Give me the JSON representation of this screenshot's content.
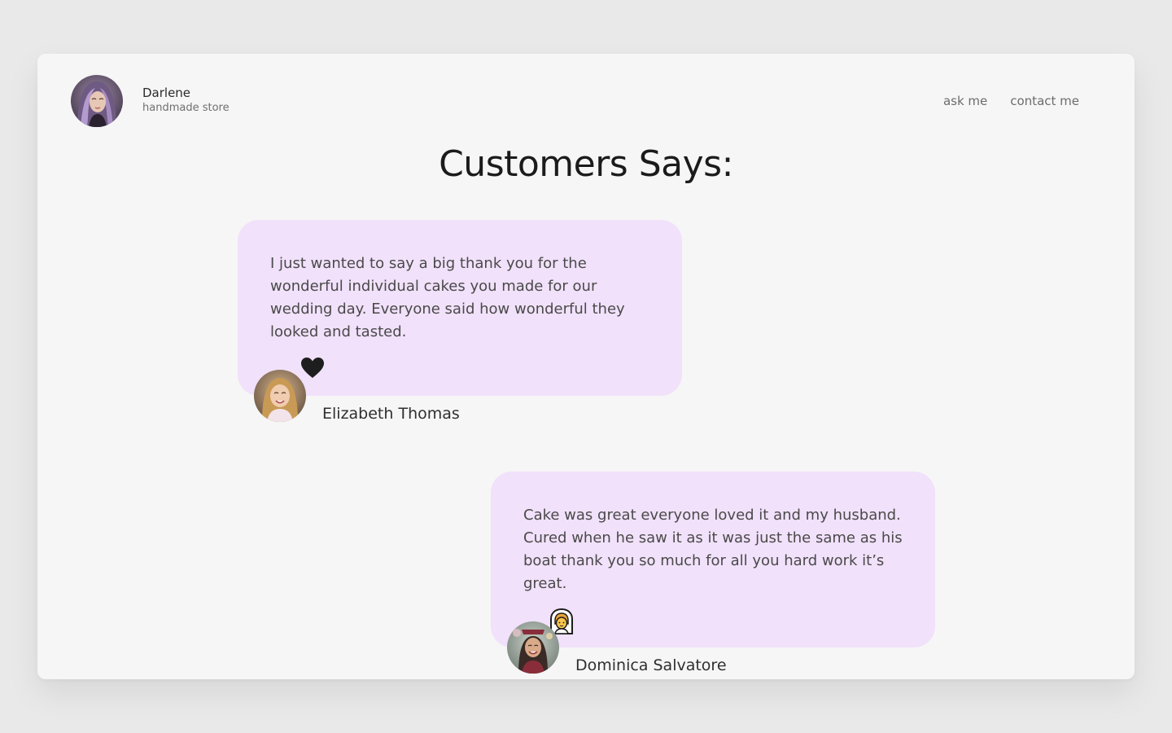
{
  "brand": {
    "name": "Darlene",
    "subtitle": "handmade store"
  },
  "nav": {
    "items": [
      "ask me",
      "contact me"
    ]
  },
  "page": {
    "title": "Customers Says:"
  },
  "testimonials": [
    {
      "text": "I just wanted to say a big thank you for the wonderful individual cakes you made for our wedding day. Everyone said how wonderful they looked and tasted.",
      "author": "Elizabeth Thomas",
      "reaction_icon": "heart-icon"
    },
    {
      "text": "Cake was great everyone loved it and my husband. Cured when he saw it as it was just the same as his boat thank you so much for all you hard work it’s great.",
      "author": "Dominica Salvatore",
      "reaction_icon": "bride-emoji-icon"
    }
  ],
  "colors": {
    "page_background": "#e9e9e9",
    "card_background": "#f6f6f6",
    "bubble_background": "#f1e1fa",
    "title_text": "#1b1b1b",
    "body_text": "#4a4a4a",
    "nav_text": "#6c6c6c"
  }
}
